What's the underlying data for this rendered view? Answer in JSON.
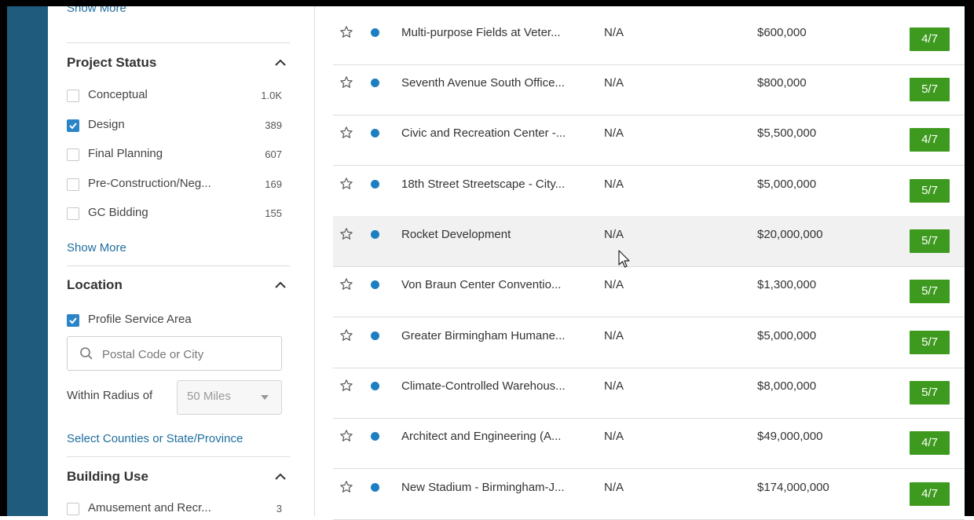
{
  "sidebar": {
    "show_more_top": "Show More",
    "project_status": {
      "title": "Project Status",
      "items": [
        {
          "label": "Conceptual",
          "count": "1.0K",
          "checked": false
        },
        {
          "label": "Design",
          "count": "389",
          "checked": true
        },
        {
          "label": "Final Planning",
          "count": "607",
          "checked": false
        },
        {
          "label": "Pre-Construction/Neg...",
          "count": "169",
          "checked": false
        },
        {
          "label": "GC Bidding",
          "count": "155",
          "checked": false
        }
      ],
      "show_more": "Show More"
    },
    "location": {
      "title": "Location",
      "profile_service_area": {
        "label": "Profile Service Area",
        "checked": true
      },
      "search": {
        "placeholder": "Postal Code or City",
        "value": ""
      },
      "radius_label": "Within Radius of",
      "radius_value": "50 Miles",
      "select_counties": "Select Counties or State/Province"
    },
    "building_use": {
      "title": "Building Use",
      "items": [
        {
          "label": "Amusement and Recr...",
          "count": "3",
          "checked": false
        }
      ]
    }
  },
  "projects": [
    {
      "name": "Multi-purpose Fields at Veter...",
      "stage": "N/A",
      "value": "$600,000",
      "badge": "4/7"
    },
    {
      "name": "Seventh Avenue South Office...",
      "stage": "N/A",
      "value": "$800,000",
      "badge": "5/7"
    },
    {
      "name": "Civic and Recreation Center -...",
      "stage": "N/A",
      "value": "$5,500,000",
      "badge": "4/7"
    },
    {
      "name": "18th Street Streetscape - City...",
      "stage": "N/A",
      "value": "$5,000,000",
      "badge": "5/7"
    },
    {
      "name": "Rocket Development",
      "stage": "N/A",
      "value": "$20,000,000",
      "badge": "5/7"
    },
    {
      "name": "Von Braun Center Conventio...",
      "stage": "N/A",
      "value": "$1,300,000",
      "badge": "5/7"
    },
    {
      "name": "Greater Birmingham Humane...",
      "stage": "N/A",
      "value": "$5,000,000",
      "badge": "5/7"
    },
    {
      "name": "Climate-Controlled Warehous...",
      "stage": "N/A",
      "value": "$8,000,000",
      "badge": "5/7"
    },
    {
      "name": "Architect and Engineering (A...",
      "stage": "N/A",
      "value": "$49,000,000",
      "badge": "4/7"
    },
    {
      "name": "New Stadium - Birmingham-J...",
      "stage": "N/A",
      "value": "$174,000,000",
      "badge": "4/7"
    }
  ],
  "icons": {
    "star": "star-outline-icon",
    "dot": "status-dot-icon",
    "caret": "chevron-up-icon",
    "search": "search-icon",
    "check": "checkmark-icon"
  },
  "colors": {
    "rail": "#1e5b7d",
    "link": "#1f6e9e",
    "check": "#2b84c6",
    "dot": "#1d7ec2",
    "badge": "#3d9a1f"
  }
}
